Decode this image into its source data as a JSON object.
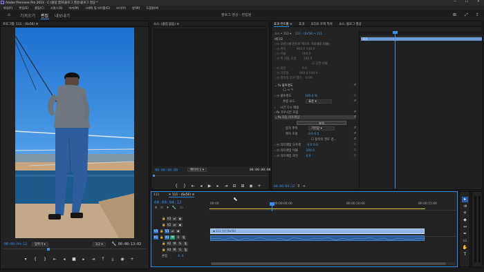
{
  "window": {
    "title": "Adobe Premiere Pro 2023 - C:\\볼링 캡쳐\\블로그 영상\\블로그 영상 *"
  },
  "menu": [
    "파일(F)",
    "편집(E)",
    "클립(C)",
    "시퀀스(S)",
    "마커(M)",
    "그래픽 및 타이틀(G)",
    "보기(V)",
    "창(W)",
    "도움말(H)"
  ],
  "workspace": {
    "tabs": [
      "가져오기",
      "편집",
      "내보내기"
    ],
    "active": "편집",
    "project_title": "블로그 영상 - 편집됨"
  },
  "program": {
    "tab": "프로그램: 111 - (6x56)",
    "timecode_left": "00:00:04:12",
    "fit_label": "맞추기",
    "quality": "1/2",
    "timecode_right": "00:00:13:02"
  },
  "source": {
    "tab": "소스: (클립 없음)",
    "timecode_left": "00:00:00:00",
    "page": "페이지 1",
    "timecode_right": "00:00:00:00"
  },
  "effects": {
    "tabs": [
      "효과 컨트롤",
      "효과",
      "오디오 트랙 믹서",
      "소스: 블로그 영상"
    ],
    "active_tab": "효과 컨트롤",
    "header": "소스 • 111",
    "clip": "111 - (6x56) • 111",
    "section_video": "비디오",
    "motion": {
      "label": "모션 (새 인트로 텍스트 가로세로 비율)",
      "rows": [
        {
          "label": "위치",
          "value": "960.0  540.0"
        },
        {
          "label": "비율",
          "value": "100.0"
        },
        {
          "label": "폭 비율 조정",
          "value": "100.0"
        },
        {
          "label": "균일 비율",
          "value": ""
        },
        {
          "label": "회전",
          "value": "0.0"
        },
        {
          "label": "기준점",
          "value": "960.0  540.0"
        },
        {
          "label": "깜박임 방지 필터",
          "value": "0.00"
        }
      ]
    },
    "opacity": {
      "label": "불투명도",
      "value": "100.0 %",
      "blend_label": "혼합 모드",
      "blend_value": "표준"
    },
    "time_remap": "시간 다시 매핑",
    "mosaic": "가우시안 흐림",
    "motion2": "자동 리프레임",
    "reframe": {
      "button": "분석",
      "motion_track_label": "동작 추적",
      "motion_track_value": "기본값",
      "position_label": "위치 조정",
      "position_value": "0.0    0.0",
      "checkbox_label": "동작의 경로 검...",
      "offset_label": "리프레임 오프셋",
      "offset_value": "0.0    0.0",
      "scale_label": "리프레임 비율",
      "scale_value": "100.0",
      "rotate_label": "리프레임 회전",
      "rotate_value": "0.0"
    },
    "mini_timeline_clip": "111",
    "timecode": "00:00:04:12"
  },
  "timeline": {
    "tabs": [
      "111",
      "111 - (6x56)"
    ],
    "timecode": "00:00:04:12",
    "ruler": [
      "00:00",
      "00:00:05:00",
      "00:00:10:00",
      "00:00:15:00"
    ],
    "video_tracks": [
      "V3",
      "V2",
      "V1"
    ],
    "audio_tracks": [
      "A1",
      "A2",
      "A3"
    ],
    "mix_label": "혼합",
    "mix_value": "0.0",
    "clip_video": "111 [V] [6x56]",
    "clip_audio": ""
  },
  "colors": {
    "accent": "#2d8ceb",
    "clip_video": "#8fb6e6",
    "clip_audio": "#2a5b9a",
    "playhead": "#3b8fe6",
    "workarea": "#e6c840"
  }
}
